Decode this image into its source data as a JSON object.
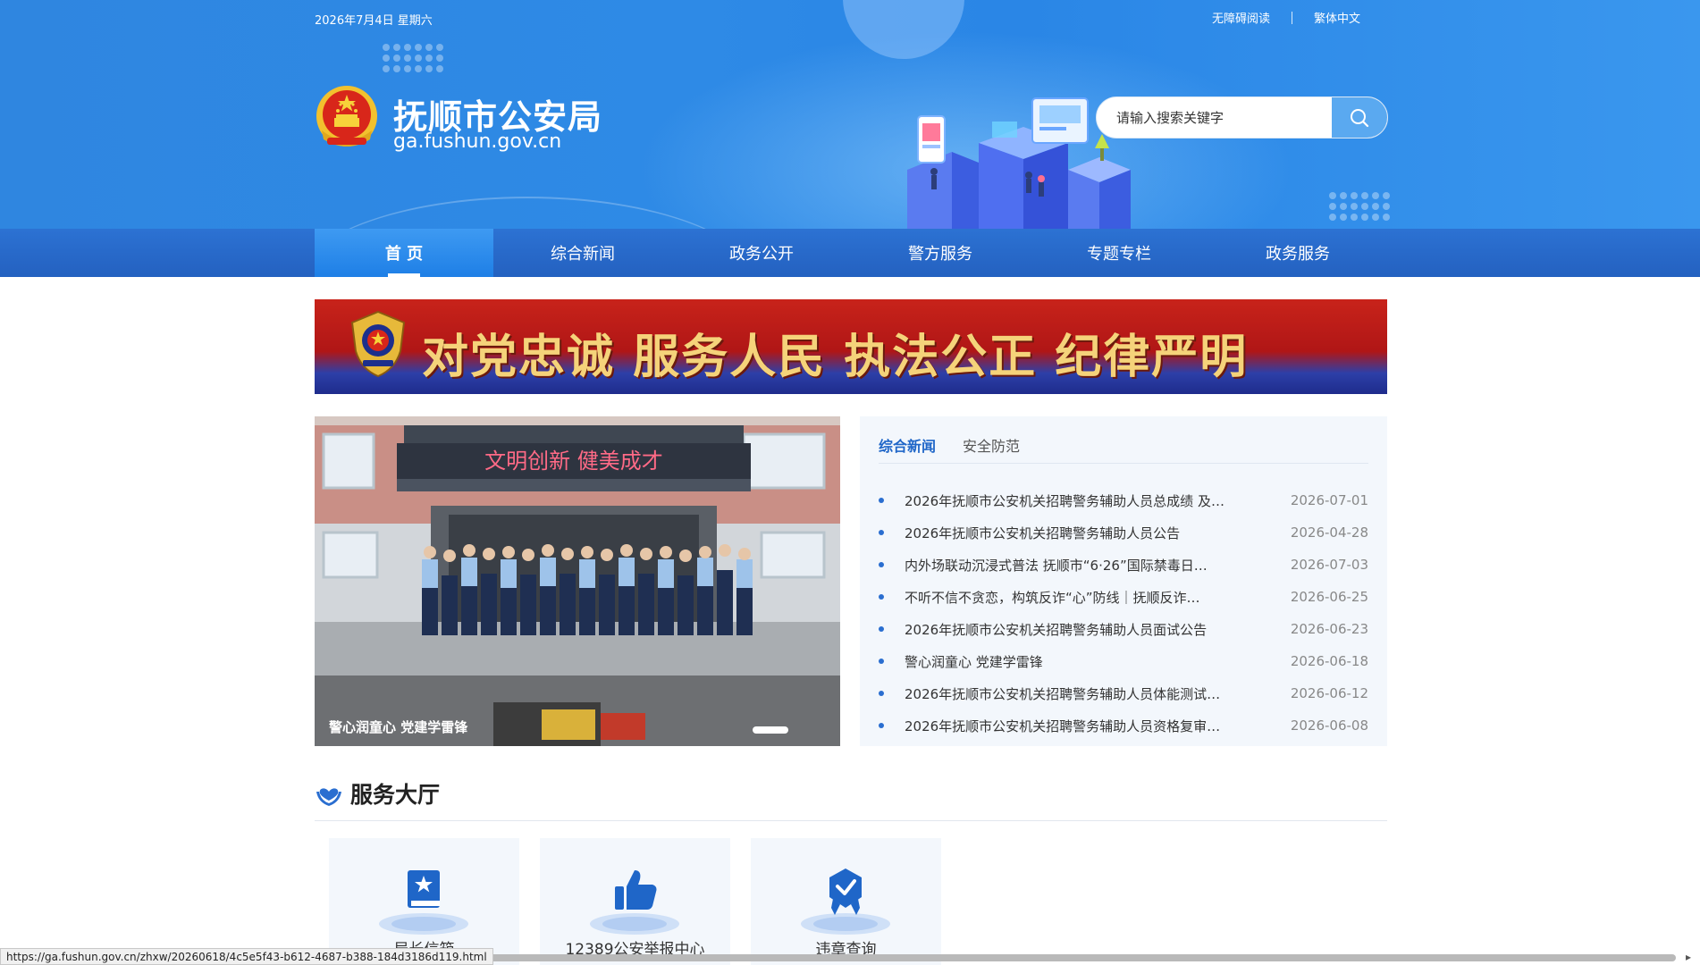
{
  "header": {
    "date": "2026年7月4日 星期六",
    "links": [
      "无障碍阅读",
      "繁体中文"
    ],
    "site_name": "抚顺市公安局",
    "site_domain": "ga.fushun.gov.cn",
    "search": {
      "placeholder": "请输入搜索关键字",
      "icon": "search-icon"
    }
  },
  "nav": {
    "items": [
      "首 页",
      "综合新闻",
      "政务公开",
      "警方服务",
      "专题专栏",
      "政务服务"
    ],
    "active_index": 0
  },
  "banner": {
    "text": "对党忠诚  服务人民  执法公正  纪律严明"
  },
  "slider": {
    "caption": "警心润童心 党建学雷锋",
    "photo_sign": "文明创新  健美成才"
  },
  "news": {
    "tabs": [
      "综合新闻",
      "安全防范"
    ],
    "active_tab": 0,
    "items": [
      {
        "title": "2026年抚顺市公安机关招聘警务辅助人员总成绩 及…",
        "date": "2026-07-01"
      },
      {
        "title": "2026年抚顺市公安机关招聘警务辅助人员公告",
        "date": "2026-04-28"
      },
      {
        "title": "内外场联动沉浸式普法 抚顺市“6·26”国际禁毒日…",
        "date": "2026-07-03"
      },
      {
        "title": "不听不信不贪恋，构筑反诈“心”防线｜抚顺反诈…",
        "date": "2026-06-25"
      },
      {
        "title": "2026年抚顺市公安机关招聘警务辅助人员面试公告",
        "date": "2026-06-23"
      },
      {
        "title": "警心润童心 党建学雷锋",
        "date": "2026-06-18"
      },
      {
        "title": "2026年抚顺市公安机关招聘警务辅助人员体能测试…",
        "date": "2026-06-12"
      },
      {
        "title": "2026年抚顺市公安机关招聘警务辅助人员资格复审…",
        "date": "2026-06-08"
      }
    ]
  },
  "service": {
    "title": "服务大厅",
    "cards": [
      {
        "label": "局长信箱",
        "icon": "mailbox-book-icon"
      },
      {
        "label": "12389公安举报中心",
        "icon": "thumbs-up-icon"
      },
      {
        "label": "违章查询",
        "icon": "badge-check-icon"
      }
    ]
  },
  "status_bar": {
    "url": "https://ga.fushun.gov.cn/zhxw/20260618/4c5e5f43-b612-4687-b388-184d3186d119.html"
  },
  "colors": {
    "header_blue": "#2e8ae6",
    "nav_blue": "#2461c0",
    "accent_blue": "#1f66c8",
    "banner_red": "#b01616",
    "banner_gold": "#f5d37a"
  }
}
